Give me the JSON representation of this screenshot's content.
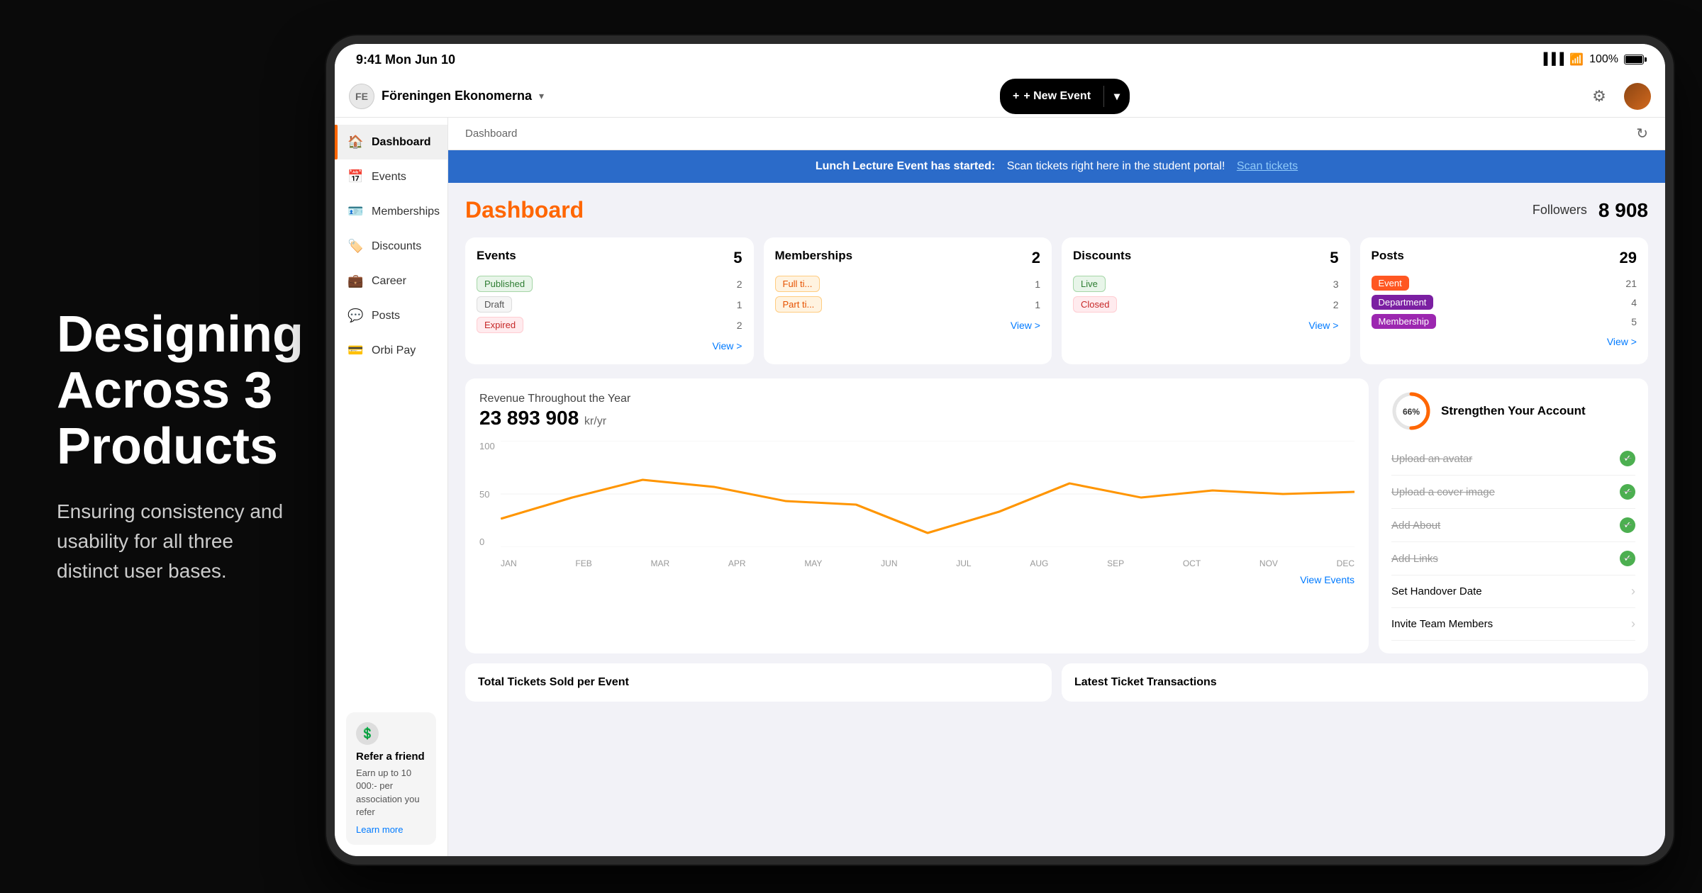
{
  "page": {
    "background": "#0a0a0a"
  },
  "left_panel": {
    "title": "Designing\nAcross 3\nProducts",
    "subtitle": "Ensuring consistency and\nusability for all three\ndistinct user bases."
  },
  "status_bar": {
    "time": "9:41  Mon Jun 10",
    "signal": "WiFi",
    "battery": "100%"
  },
  "top_nav": {
    "org_name": "Föreningen Ekonomerna",
    "new_event_label": "+ New Event",
    "chevron": "▾"
  },
  "breadcrumb": {
    "label": "Dashboard"
  },
  "notification": {
    "text": "Lunch Lecture Event has started:",
    "detail": "Scan tickets right here in the student portal!",
    "link_text": "Scan tickets"
  },
  "sidebar": {
    "items": [
      {
        "id": "dashboard",
        "label": "Dashboard",
        "icon": "🏠",
        "active": true
      },
      {
        "id": "events",
        "label": "Events",
        "icon": "📅",
        "active": false
      },
      {
        "id": "memberships",
        "label": "Memberships",
        "icon": "🪪",
        "active": false
      },
      {
        "id": "discounts",
        "label": "Discounts",
        "icon": "🏷️",
        "active": false
      },
      {
        "id": "career",
        "label": "Career",
        "icon": "💼",
        "active": false
      },
      {
        "id": "posts",
        "label": "Posts",
        "icon": "💬",
        "active": false
      },
      {
        "id": "orbi-pay",
        "label": "Orbi Pay",
        "icon": "💳",
        "active": false
      }
    ],
    "refer": {
      "icon": "💲",
      "title": "Refer a friend",
      "text": "Earn up to 10 000:- per association you refer",
      "link": "Learn more"
    }
  },
  "dashboard": {
    "title": "Dashboard",
    "followers_label": "Followers",
    "followers_count": "8 908",
    "stats": {
      "events": {
        "title": "Events",
        "total": 5,
        "rows": [
          {
            "badge": "Published",
            "badge_type": "green",
            "count": 2
          },
          {
            "badge": "Draft",
            "badge_type": "gray",
            "count": 1
          },
          {
            "badge": "Expired",
            "badge_type": "red",
            "count": 2
          }
        ],
        "view_link": "View >"
      },
      "memberships": {
        "title": "Memberships",
        "total": 2,
        "rows": [
          {
            "badge": "Full ti...",
            "badge_type": "orange",
            "count": 1
          },
          {
            "badge": "Part ti...",
            "badge_type": "orange",
            "count": 1
          }
        ],
        "view_link": "View >"
      },
      "discounts": {
        "title": "Discounts",
        "total": 5,
        "rows": [
          {
            "badge": "Live",
            "badge_type": "green",
            "count": 3
          },
          {
            "badge": "Closed",
            "badge_type": "red",
            "count": 2
          }
        ],
        "view_link": "View >"
      },
      "posts": {
        "title": "Posts",
        "total": 29,
        "rows": [
          {
            "badge": "Event",
            "badge_type": "event",
            "count": 21
          },
          {
            "badge": "Department",
            "badge_type": "dept",
            "count": 4
          },
          {
            "badge": "Membership",
            "badge_type": "membership",
            "count": 5
          }
        ],
        "view_link": "View >"
      }
    },
    "revenue": {
      "title": "Revenue Throughout the Year",
      "amount": "23 893 908",
      "unit": "kr/yr",
      "months": [
        "JAN",
        "FEB",
        "MAR",
        "APR",
        "MAY",
        "JUN",
        "JUL",
        "AUG",
        "SEP",
        "OCT",
        "NOV",
        "DEC"
      ],
      "y_labels": [
        "100",
        "50",
        "0"
      ],
      "view_events_link": "View Events"
    },
    "strengthen": {
      "percent": 66,
      "title": "Strengthen Your Account",
      "items": [
        {
          "label": "Upload an avatar",
          "completed": true
        },
        {
          "label": "Upload a cover image",
          "completed": true
        },
        {
          "label": "Add About",
          "completed": true
        },
        {
          "label": "Add Links",
          "completed": true
        },
        {
          "label": "Set Handover Date",
          "completed": false
        },
        {
          "label": "Invite Team Members",
          "completed": false
        }
      ]
    },
    "bottom_sections": {
      "tickets": "Total Tickets Sold per Event",
      "transactions": "Latest Ticket Transactions"
    }
  }
}
